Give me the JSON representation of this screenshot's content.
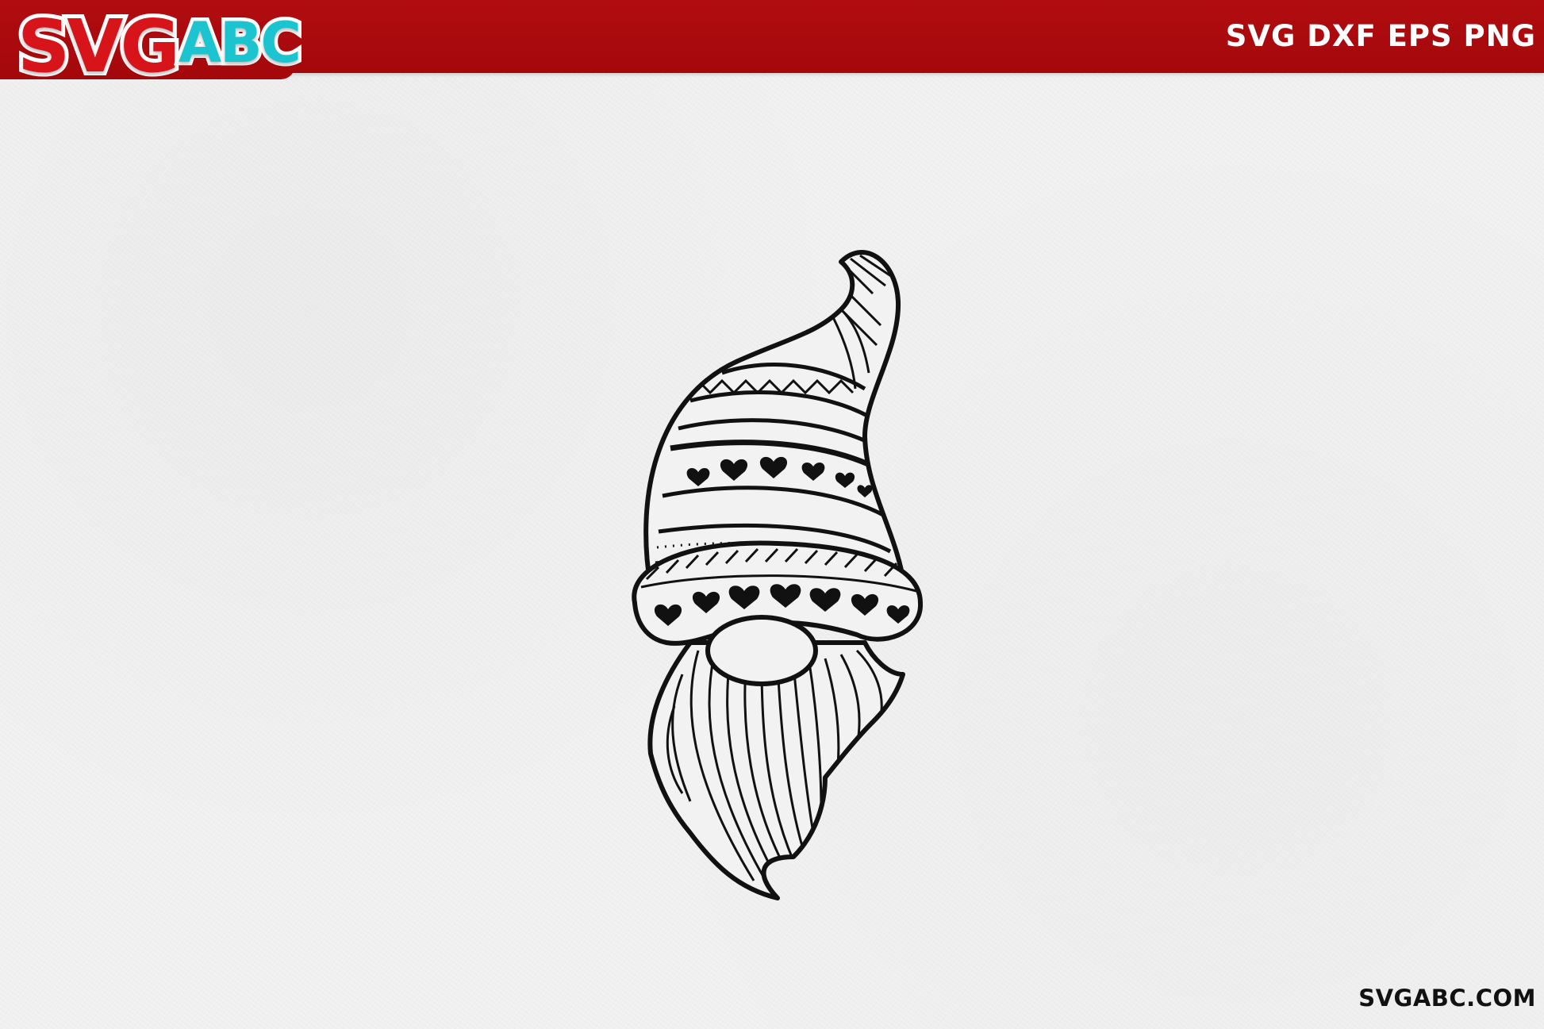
{
  "header": {
    "logo_primary": "SVG",
    "logo_secondary": "ABC",
    "formats": "SVG DXF EPS PNG"
  },
  "footer": {
    "site": "SVGABC.COM"
  },
  "artwork": {
    "subject": "gnome-icon"
  },
  "colors": {
    "banner_red": "#a90a0d",
    "logo_red": "#d8141b",
    "logo_cyan": "#1cc4cf",
    "paper": "#f2f2f2",
    "ink": "#111111"
  }
}
